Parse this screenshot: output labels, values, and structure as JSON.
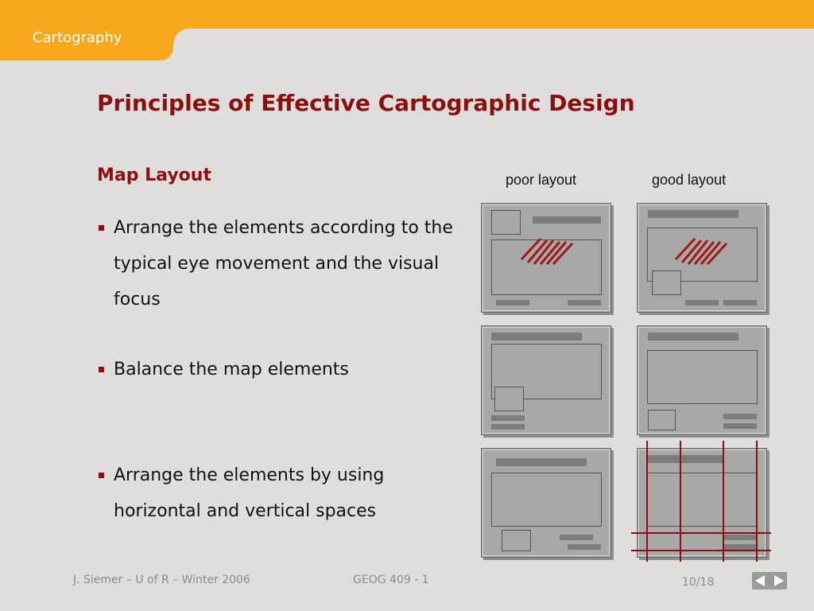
{
  "header": {
    "tab_label": "Cartography"
  },
  "slide": {
    "title": "Principles of Effective Cartographic Design",
    "subtitle": "Map Layout",
    "bullets": [
      "Arrange the elements according to the typical eye movement and the visual focus",
      "Balance the map elements",
      "Arrange the elements by using horizontal and vertical spaces"
    ],
    "columns": {
      "poor": "poor layout",
      "good": "good layout"
    }
  },
  "footer": {
    "author": "J. Siemer – U of R – Winter 2006",
    "course": "GEOG 409 - 1",
    "page": "10/18"
  },
  "colors": {
    "accent_orange": "#f8a81c",
    "title_red": "#8c0f10",
    "background": "#e0dedc"
  },
  "icons": {
    "prev": "triangle-left-icon",
    "next": "triangle-right-icon"
  }
}
